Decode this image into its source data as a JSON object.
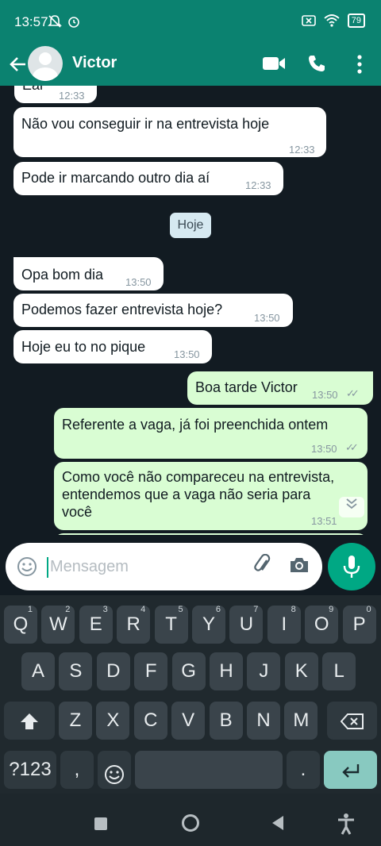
{
  "status_bar": {
    "time": "13:57",
    "battery": "79"
  },
  "header": {
    "back_icon": "arrow-left-icon",
    "contact_name": "Victor"
  },
  "chat": {
    "day_label": "Hoje",
    "messages": [
      {
        "dir": "in",
        "text": "Eai",
        "time": "12:33"
      },
      {
        "dir": "in",
        "text": "Não vou conseguir ir na entrevista hoje",
        "time": "12:33"
      },
      {
        "dir": "in",
        "text": "Pode ir marcando outro dia aí",
        "time": "12:33"
      },
      {
        "dir": "in",
        "text": "Opa bom dia",
        "time": "13:50"
      },
      {
        "dir": "in",
        "text": "Podemos fazer entrevista hoje?",
        "time": "13:50"
      },
      {
        "dir": "in",
        "text": "Hoje eu to no pique",
        "time": "13:50"
      },
      {
        "dir": "out",
        "text": "Boa tarde Victor",
        "time": "13:50"
      },
      {
        "dir": "out",
        "text": "Referente a vaga, já foi preenchida ontem",
        "time": "13:50"
      },
      {
        "dir": "out",
        "text_lines": [
          "Como você não compareceu na entrevista,",
          "entendemos que a vaga não seria para",
          "você"
        ],
        "time": "13:51"
      }
    ]
  },
  "composer": {
    "placeholder": "Mensagem"
  },
  "keyboard": {
    "row1": [
      {
        "k": "Q",
        "h": "1"
      },
      {
        "k": "W",
        "h": "2"
      },
      {
        "k": "E",
        "h": "3"
      },
      {
        "k": "R",
        "h": "4"
      },
      {
        "k": "T",
        "h": "5"
      },
      {
        "k": "Y",
        "h": "6"
      },
      {
        "k": "U",
        "h": "7"
      },
      {
        "k": "I",
        "h": "8"
      },
      {
        "k": "O",
        "h": "9"
      },
      {
        "k": "P",
        "h": "0"
      }
    ],
    "row2": [
      "A",
      "S",
      "D",
      "F",
      "G",
      "H",
      "J",
      "K",
      "L"
    ],
    "row3": [
      "Z",
      "X",
      "C",
      "V",
      "B",
      "N",
      "M"
    ],
    "symbols_label": "?123",
    "comma": ",",
    "period": "."
  },
  "colors": {
    "header": "#0b8270",
    "outgoing": "#d9fdd3",
    "incoming": "#ffffff",
    "accent": "#00a884"
  }
}
